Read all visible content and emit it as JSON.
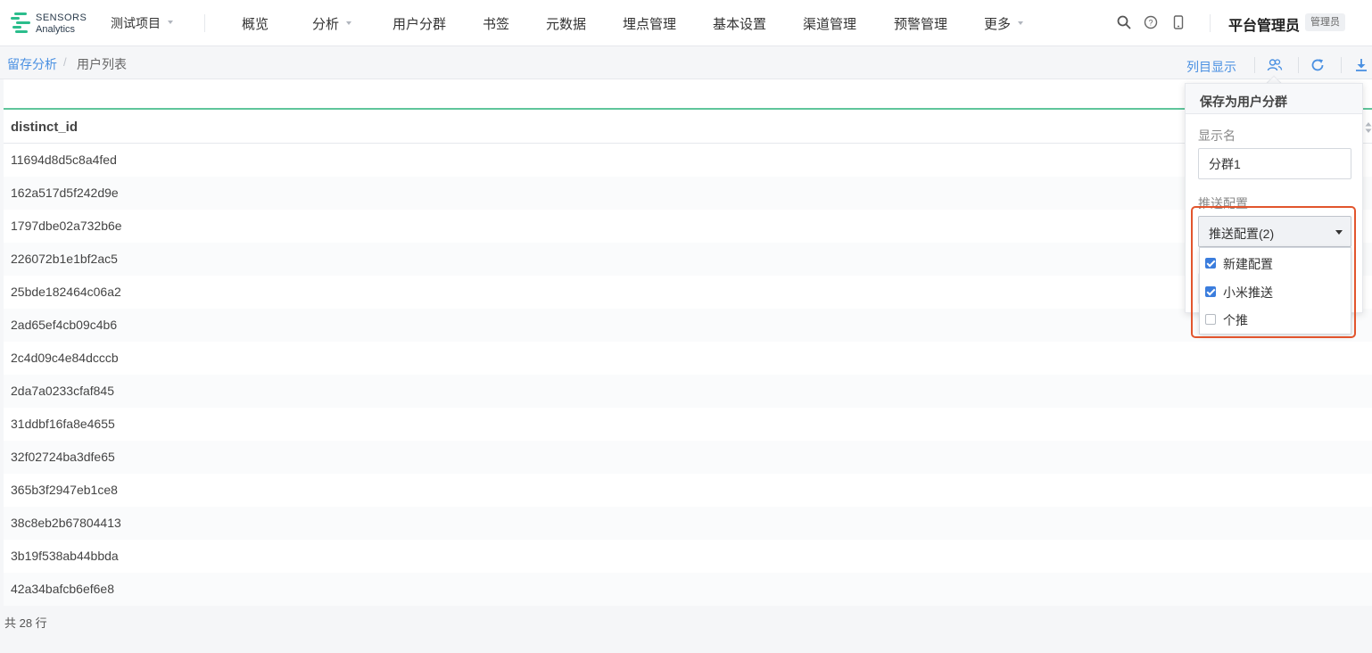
{
  "brand": {
    "line1": "SENSORS",
    "line2": "Analytics",
    "accent": "#2bbd8c"
  },
  "project": {
    "label": "测试项目"
  },
  "nav": [
    {
      "label": "概览",
      "has_caret": false
    },
    {
      "label": "分析",
      "has_caret": true
    },
    {
      "label": "用户分群",
      "has_caret": false
    },
    {
      "label": "书签",
      "has_caret": false
    },
    {
      "label": "元数据",
      "has_caret": false
    },
    {
      "label": "埋点管理",
      "has_caret": false
    },
    {
      "label": "基本设置",
      "has_caret": false
    },
    {
      "label": "渠道管理",
      "has_caret": false
    },
    {
      "label": "预警管理",
      "has_caret": false
    },
    {
      "label": "更多",
      "has_caret": true
    }
  ],
  "top_icons": [
    "search-icon",
    "help-icon",
    "mobile-icon"
  ],
  "user": {
    "name": "平台管理员",
    "role": "管理员"
  },
  "breadcrumb": {
    "parent": "留存分析",
    "separator": "/",
    "current": "用户列表"
  },
  "toolbar": {
    "column_display": "列目显示",
    "icons": [
      "save-segment-icon",
      "refresh-icon",
      "download-icon"
    ],
    "link_color": "#4a90e2"
  },
  "table": {
    "header": "distinct_id",
    "rows": [
      "11694d8d5c8a4fed",
      "162a517d5f242d9e",
      "1797dbe02a732b6e",
      "226072b1e1bf2ac5",
      "25bde182464c06a2",
      "2ad65ef4cb09c4b6",
      "2c4d09c4e84dcccb",
      "2da7a0233cfaf845",
      "31ddbf16fa8e4655",
      "32f02724ba3dfe65",
      "365b3f2947eb1ce8",
      "38c8eb2b67804413",
      "3b19f538ab44bbda",
      "42a34bafcb6ef6e8"
    ],
    "total": "共 28 行"
  },
  "popover": {
    "title": "保存为用户分群",
    "name_label": "显示名",
    "name_value": "分群1",
    "push_label": "推送配置",
    "push_select_value": "推送配置(2)",
    "push_options": [
      {
        "label": "新建配置",
        "checked": true
      },
      {
        "label": "小米推送",
        "checked": true
      },
      {
        "label": "个推",
        "checked": false
      }
    ],
    "highlight_color": "#e2552d"
  }
}
